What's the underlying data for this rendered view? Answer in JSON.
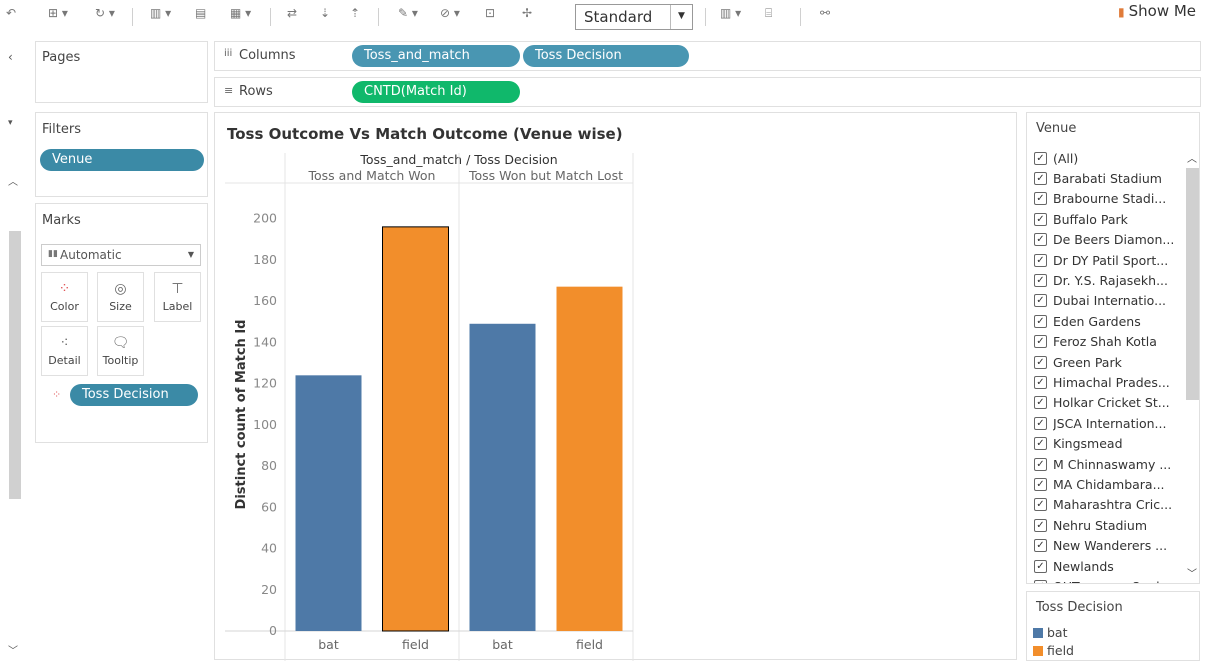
{
  "toolbar": {
    "fit_value": "Standard",
    "show_me_label": "Show Me"
  },
  "pages": {
    "title": "Pages"
  },
  "columns": {
    "title": "Columns",
    "pills": [
      "Toss_and_match",
      "Toss Decision"
    ]
  },
  "rows": {
    "title": "Rows",
    "pills": [
      "CNTD(Match Id)"
    ]
  },
  "filters": {
    "title": "Filters",
    "pills": [
      "Venue"
    ]
  },
  "marks": {
    "title": "Marks",
    "type": "Automatic",
    "buttons": [
      "Color",
      "Size",
      "Label",
      "Detail",
      "Tooltip"
    ],
    "pill": "Toss Decision"
  },
  "venue_filter": {
    "title": "Venue",
    "items": [
      "(All)",
      "Barabati Stadium",
      "Brabourne Stadi...",
      "Buffalo Park",
      "De Beers Diamon...",
      "Dr DY Patil Sport...",
      "Dr. Y.S. Rajasekh...",
      "Dubai Internatio...",
      "Eden Gardens",
      "Feroz Shah Kotla",
      "Green Park",
      "Himachal Prades...",
      "Holkar Cricket St...",
      "JSCA Internation...",
      "Kingsmead",
      "M Chinnaswamy ...",
      "MA Chidambara...",
      "Maharashtra Cric...",
      "Nehru Stadium",
      "New Wanderers ...",
      "Newlands",
      "OUTsurance Oval"
    ]
  },
  "toss_legend": {
    "title": "Toss Decision",
    "items": [
      {
        "label": "bat",
        "color": "#4e79a7"
      },
      {
        "label": "field",
        "color": "#f28e2b"
      }
    ]
  },
  "chart_data": {
    "type": "bar",
    "title": "Toss Outcome Vs Match Outcome (Venue wise)",
    "header_title": "Toss_and_match / Toss Decision",
    "groups": [
      "Toss and Match Won",
      "Toss Won but Match Lost"
    ],
    "categories": [
      "bat",
      "field",
      "bat",
      "field"
    ],
    "group_index": [
      0,
      0,
      1,
      1
    ],
    "values": [
      124,
      196,
      149,
      167
    ],
    "colors": [
      "#4e79a7",
      "#f28e2b",
      "#4e79a7",
      "#f28e2b"
    ],
    "highlighted": [
      false,
      true,
      false,
      false
    ],
    "ylabel": "Distinct count of Match Id",
    "ylim": [
      0,
      210
    ],
    "yticks": [
      0,
      20,
      40,
      60,
      80,
      100,
      120,
      140,
      160,
      180,
      200
    ],
    "grid": false,
    "legend": "separate"
  }
}
